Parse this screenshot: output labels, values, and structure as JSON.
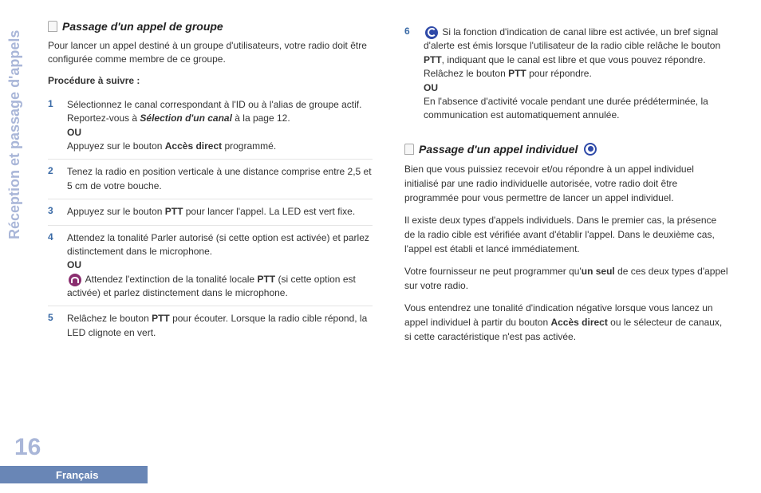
{
  "sidebar": {
    "vertical_label": "Réception et passage d'appels",
    "page_number": "16",
    "language": "Français"
  },
  "left": {
    "heading": "Passage d'un appel de groupe",
    "intro": "Pour lancer un appel destiné à un groupe d'utilisateurs, votre radio doit être configurée comme membre de ce groupe.",
    "procedure_label": "Procédure à suivre :",
    "ou": "OU",
    "steps": [
      {
        "n": "1",
        "a": "Sélectionnez le canal correspondant à l'ID ou à l'alias de groupe actif. Reportez-vous à ",
        "ref": "Sélection d'un canal",
        "b": " à la page 12.",
        "c": "Appuyez sur le bouton ",
        "em1": "Accès direct",
        "d": " programmé."
      },
      {
        "n": "2",
        "a": "Tenez la radio en position verticale à une distance comprise entre 2,5 et 5 cm de votre bouche."
      },
      {
        "n": "3",
        "a": "Appuyez sur le bouton ",
        "em1": "PTT",
        "b": " pour lancer l'appel. La LED est vert fixe."
      },
      {
        "n": "4",
        "a": "Attendez la tonalité Parler autorisé (si cette option est activée) et parlez distinctement dans le microphone.",
        "c": " Attendez l'extinction de la tonalité locale ",
        "em1": "PTT",
        "d": " (si cette option est activée) et parlez distinctement dans le microphone."
      },
      {
        "n": "5",
        "a": "Relâchez le bouton ",
        "em1": "PTT",
        "b": " pour écouter. Lorsque la radio cible répond, la LED clignote en vert."
      }
    ]
  },
  "right": {
    "step6": {
      "n": "6",
      "a": " Si la fonction d'indication de canal libre est activée, un bref signal d'alerte est émis lorsque l'utilisateur de la radio cible relâche le bouton ",
      "em1": "PTT",
      "b": ", indiquant que le canal est libre et que vous pouvez répondre. Relâchez le bouton ",
      "em2": "PTT",
      "c": " pour répondre.",
      "d": "En l'absence d'activité vocale pendant une durée prédéterminée, la communication est automatiquement annulée."
    },
    "heading": "Passage d'un appel individuel",
    "p1": "Bien que vous puissiez recevoir et/ou répondre à un appel individuel initialisé par une radio individuelle autorisée, votre radio doit être programmée pour vous permettre de lancer un appel individuel.",
    "p2": "Il existe deux types d'appels individuels. Dans le premier cas, la présence de la radio cible est vérifiée avant d'établir l'appel. Dans le deuxième cas, l'appel est établi et lancé immédiatement.",
    "p3a": "Votre fournisseur ne peut programmer qu'",
    "p3em": "un seul",
    "p3b": " de ces deux types d'appel sur votre radio.",
    "p4a": "Vous entendrez une tonalité d'indication négative lorsque vous lancez un appel individuel à partir du bouton ",
    "p4em": "Accès direct",
    "p4b": " ou le sélecteur de canaux, si cette caractéristique n'est pas activée."
  }
}
